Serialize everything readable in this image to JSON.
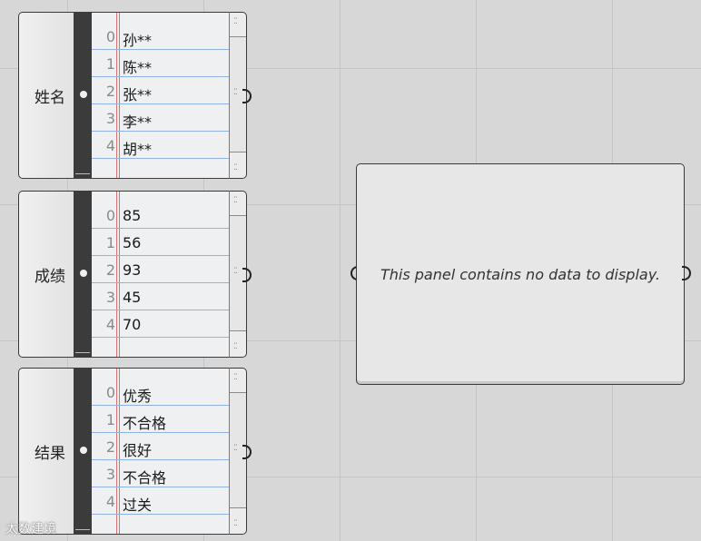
{
  "panels": [
    {
      "label": "姓名",
      "rows": [
        {
          "index": "0",
          "value": "孙**"
        },
        {
          "index": "1",
          "value": "陈**"
        },
        {
          "index": "2",
          "value": "张**"
        },
        {
          "index": "3",
          "value": "李**"
        },
        {
          "index": "4",
          "value": "胡**"
        }
      ]
    },
    {
      "label": "成绩",
      "rows": [
        {
          "index": "0",
          "value": "85"
        },
        {
          "index": "1",
          "value": "56"
        },
        {
          "index": "2",
          "value": "93"
        },
        {
          "index": "3",
          "value": "45"
        },
        {
          "index": "4",
          "value": "70"
        }
      ]
    },
    {
      "label": "结果",
      "rows": [
        {
          "index": "0",
          "value": "优秀"
        },
        {
          "index": "1",
          "value": "不合格"
        },
        {
          "index": "2",
          "value": "很好"
        },
        {
          "index": "3",
          "value": "不合格"
        },
        {
          "index": "4",
          "value": "过关"
        }
      ]
    }
  ],
  "empty_panel": {
    "message": "This panel contains no data to display."
  },
  "watermark": {
    "text": "太数建境"
  },
  "icons": {
    "grip": "grip-dots-icon",
    "port": "connector-port-icon"
  },
  "colors": {
    "canvas": "#d7d7d7",
    "grid": "#c5c5c5",
    "strip": "#3b3b3b",
    "rule_line": "#8fb3e6",
    "margin_line": "#e07070"
  }
}
